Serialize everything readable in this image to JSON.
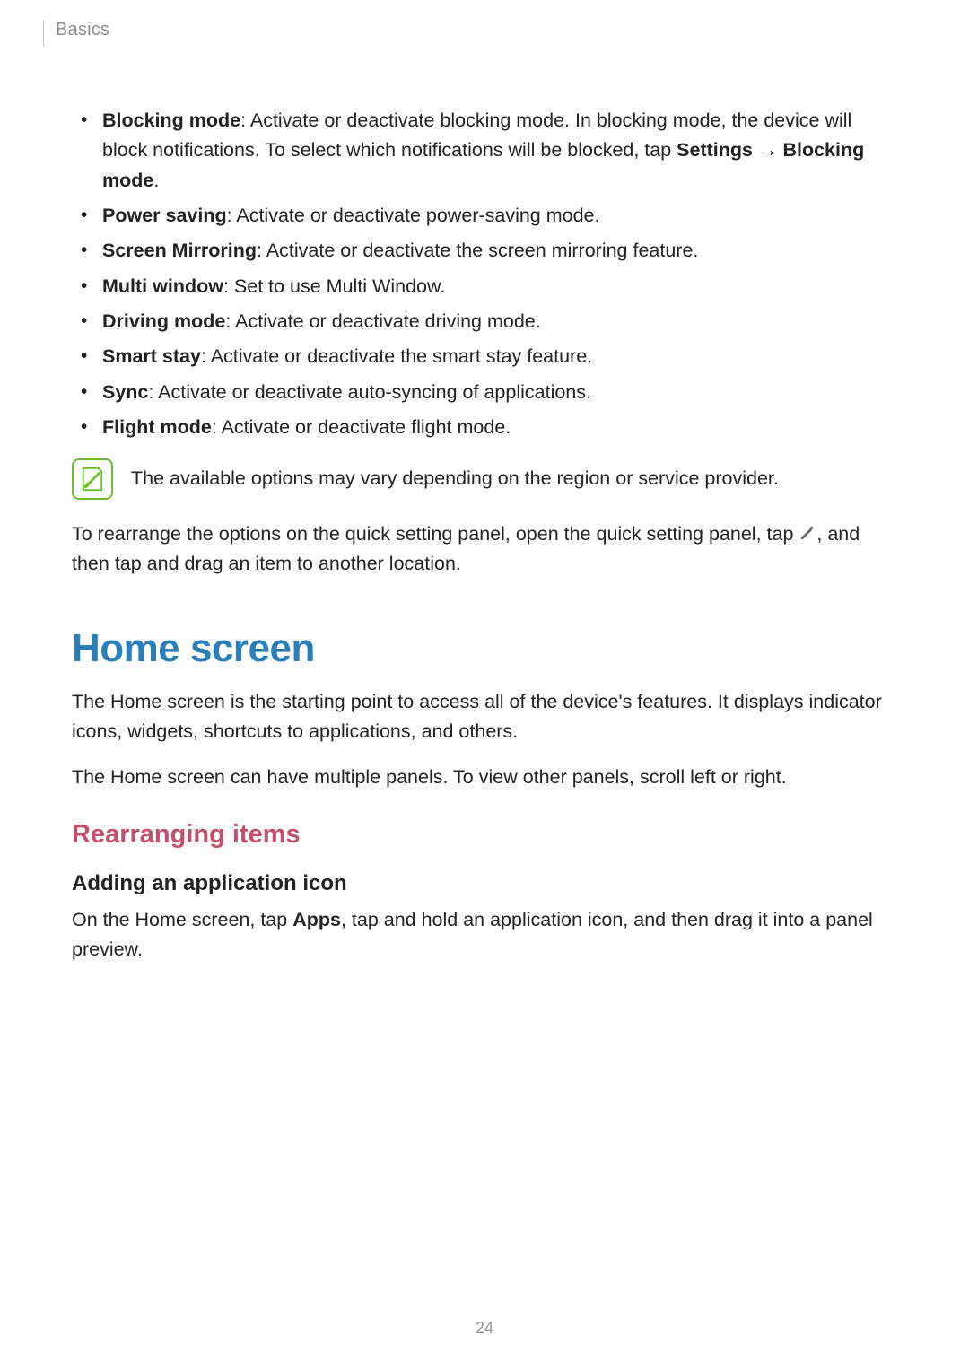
{
  "header": {
    "breadcrumb": "Basics"
  },
  "bullets": [
    {
      "title": "Blocking mode",
      "text_before_inline": ": Activate or deactivate blocking mode. In blocking mode, the device will block notifications. To select which notifications will be blocked, tap ",
      "inline_bold_1": "Settings",
      "arrow": " → ",
      "inline_bold_2": "Blocking mode",
      "tail": "."
    },
    {
      "title": "Power saving",
      "rest": ": Activate or deactivate power-saving mode."
    },
    {
      "title": "Screen Mirroring",
      "rest": ": Activate or deactivate the screen mirroring feature."
    },
    {
      "title": "Multi window",
      "rest": ": Set to use Multi Window."
    },
    {
      "title": "Driving mode",
      "rest": ": Activate or deactivate driving mode."
    },
    {
      "title": "Smart stay",
      "rest": ": Activate or deactivate the smart stay feature."
    },
    {
      "title": "Sync",
      "rest": ": Activate or deactivate auto-syncing of applications."
    },
    {
      "title": "Flight mode",
      "rest": ": Activate or deactivate flight mode."
    }
  ],
  "note": {
    "text": "The available options may vary depending on the region or service provider."
  },
  "rearrange_para": {
    "before_icon": "To rearrange the options on the quick setting panel, open the quick setting panel, tap ",
    "after_icon": ", and then tap and drag an item to another location."
  },
  "home": {
    "title": "Home screen",
    "p1": "The Home screen is the starting point to access all of the device's features. It displays indicator icons, widgets, shortcuts to applications, and others.",
    "p2": "The Home screen can have multiple panels. To view other panels, scroll left or right.",
    "sub": "Rearranging items",
    "subsub": "Adding an application icon",
    "p3_before": "On the Home screen, tap ",
    "p3_bold": "Apps",
    "p3_after": ", tap and hold an application icon, and then drag it into a panel preview."
  },
  "page_number": "24"
}
